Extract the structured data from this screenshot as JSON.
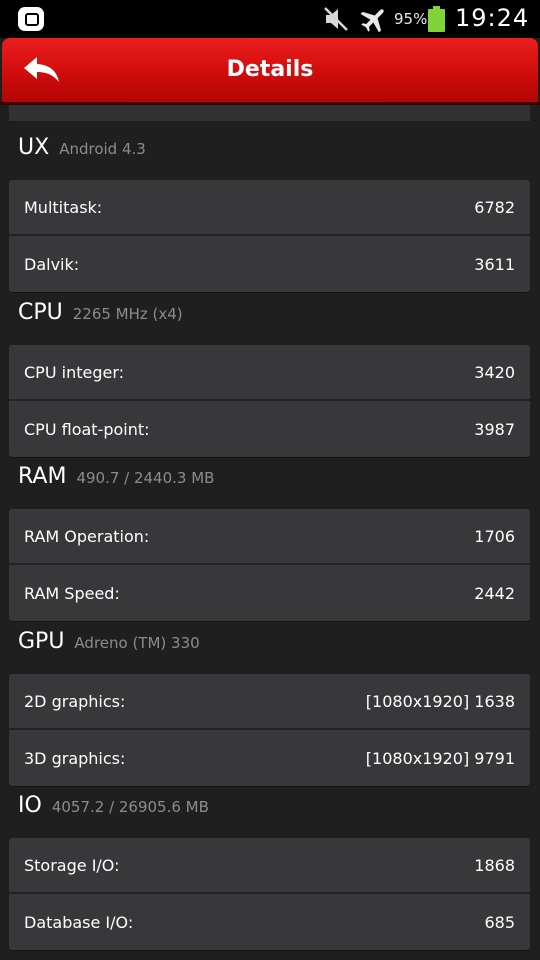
{
  "status_bar": {
    "battery_percent": "95%",
    "time": "19:24",
    "icons": [
      "app-notification-icon",
      "mute-icon",
      "airplane-mode-icon",
      "battery-icon"
    ]
  },
  "header": {
    "title": "Details",
    "back_icon": "back-arrow-icon",
    "color": "#d00c0c"
  },
  "sections": [
    {
      "title": "UX",
      "subtitle": "Android 4.3",
      "rows": [
        {
          "label": "Multitask:",
          "value": "6782"
        },
        {
          "label": "Dalvik:",
          "value": "3611"
        }
      ]
    },
    {
      "title": "CPU",
      "subtitle": "2265 MHz (x4)",
      "rows": [
        {
          "label": "CPU integer:",
          "value": "3420"
        },
        {
          "label": "CPU float-point:",
          "value": "3987"
        }
      ]
    },
    {
      "title": "RAM",
      "subtitle": "490.7 / 2440.3 MB",
      "rows": [
        {
          "label": "RAM Operation:",
          "value": "1706"
        },
        {
          "label": "RAM Speed:",
          "value": "2442"
        }
      ]
    },
    {
      "title": "GPU",
      "subtitle": "Adreno (TM) 330",
      "rows": [
        {
          "label": "2D graphics:",
          "value": "[1080x1920] 1638"
        },
        {
          "label": "3D graphics:",
          "value": "[1080x1920] 9791"
        }
      ]
    },
    {
      "title": "IO",
      "subtitle": "4057.2 / 26905.6 MB",
      "rows": [
        {
          "label": "Storage I/O:",
          "value": "1868"
        },
        {
          "label": "Database I/O:",
          "value": "685"
        }
      ]
    }
  ]
}
